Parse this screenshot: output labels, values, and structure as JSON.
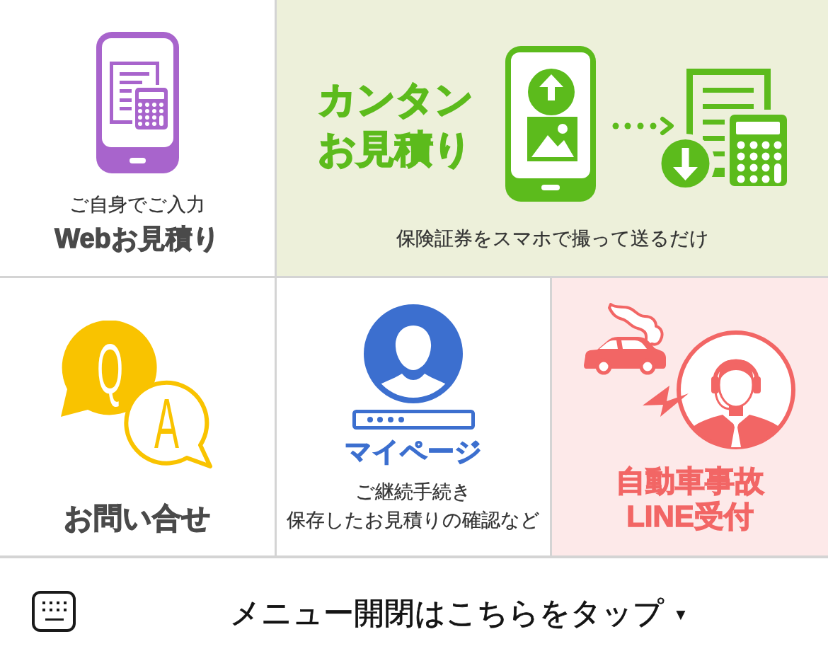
{
  "menu_tiles": [
    {
      "kind": "web_estimate",
      "subtitle": "ご自身でご入力",
      "title": "Webお見積り"
    },
    {
      "kind": "photo_estimate",
      "title_lines": [
        "カンタン",
        "お見積り"
      ],
      "caption": "保険証券をスマホで撮って送るだけ"
    },
    {
      "kind": "inquiry",
      "bubble_letters": [
        "Q",
        "A"
      ],
      "title": "お問い合せ"
    },
    {
      "kind": "my_page",
      "title": "マイページ",
      "description_lines": [
        "ご継続手続き",
        "保存したお見積りの確認など"
      ]
    },
    {
      "kind": "accident_report",
      "title_lines": [
        "自動車事故",
        "LINE受付"
      ]
    }
  ],
  "menu_bar": {
    "toggle_label": "メニュー開閉はこちらをタップ",
    "caret": "▼"
  }
}
